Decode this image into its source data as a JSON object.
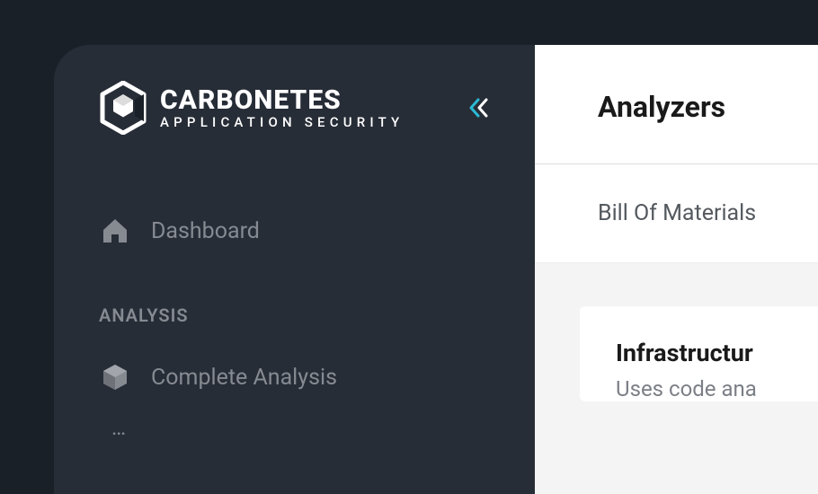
{
  "brand": {
    "name": "CARBONETES",
    "tagline": "APPLICATION SECURITY"
  },
  "sidebar": {
    "items": [
      {
        "label": "Dashboard"
      }
    ],
    "section_label": "ANALYSIS",
    "analysis_items": [
      {
        "label": "Complete Analysis"
      }
    ]
  },
  "panel": {
    "title": "Analyzers",
    "tabs": [
      {
        "label": "Bill Of Materials"
      }
    ],
    "card": {
      "title": "Infrastructur",
      "description": "Uses code ana"
    }
  }
}
